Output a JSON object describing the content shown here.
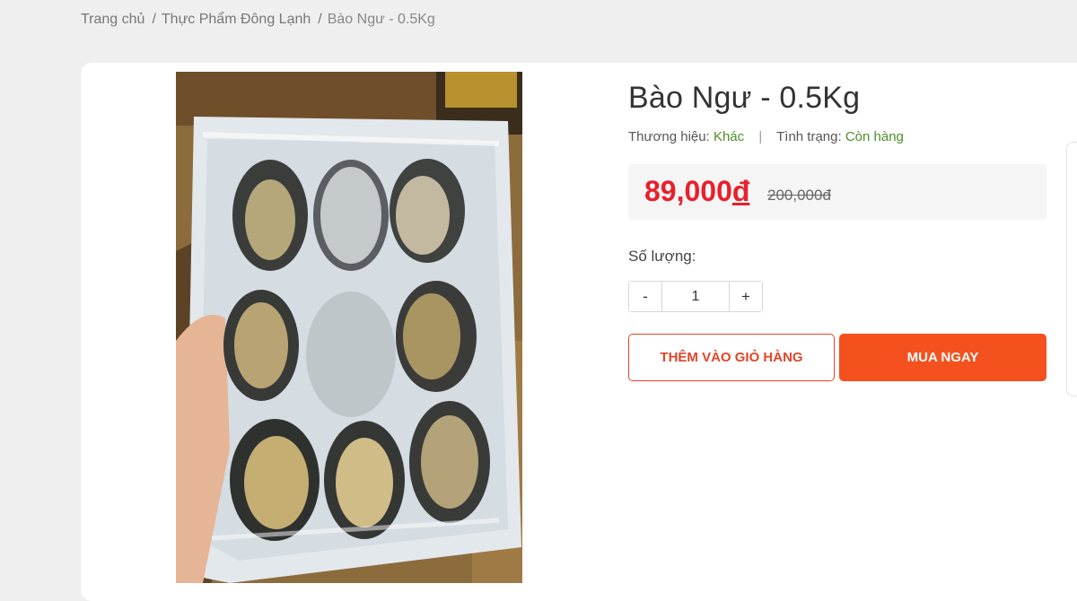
{
  "breadcrumb": {
    "home": "Trang chủ",
    "category": "Thực Phẩm Đông Lạnh",
    "current": "Bào Ngư - 0.5Kg",
    "separator": "/"
  },
  "product": {
    "title": "Bào Ngư - 0.5Kg",
    "image_icon": "product-photo-abalone",
    "brand_label": "Thương hiệu:",
    "brand_value": "Khác",
    "meta_divider": "|",
    "status_label": "Tình trạng:",
    "status_value": "Còn hàng",
    "price_amount": "89,000",
    "price_currency": "đ",
    "old_price": "200,000đ"
  },
  "quantity": {
    "label": "Số lượng:",
    "minus": "-",
    "value": "1",
    "plus": "+"
  },
  "actions": {
    "add_to_cart": "THÊM VÀO GIỎ HÀNG",
    "buy_now": "MUA NGAY"
  },
  "colors": {
    "price_red": "#e8202d",
    "accent_orange": "#f4511e",
    "status_green": "#4b8f27"
  }
}
